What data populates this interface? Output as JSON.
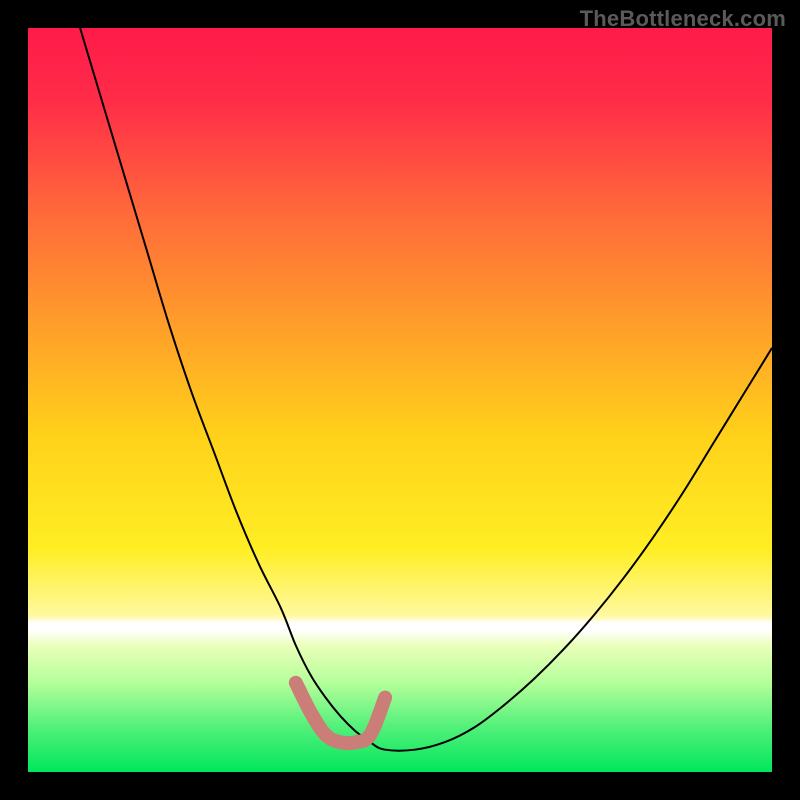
{
  "watermark": "TheBottleneck.com",
  "chart_data": {
    "type": "line",
    "title": "",
    "xlabel": "",
    "ylabel": "",
    "xlim": [
      0,
      100
    ],
    "ylim": [
      0,
      100
    ],
    "grid": false,
    "legend": false,
    "background_gradient": {
      "top_color": "#ff1a4a",
      "mid_color": "#ffe600",
      "bottom_color": "#00e65c",
      "white_band_y_pct": 80
    },
    "series": [
      {
        "name": "bottleneck-curve",
        "color": "#000000",
        "stroke_width": 2,
        "x": [
          7,
          10,
          13,
          16,
          19,
          22,
          25,
          28,
          31,
          34,
          36,
          38,
          40,
          42,
          44,
          46,
          48,
          52,
          56,
          60,
          64,
          68,
          72,
          76,
          80,
          84,
          88,
          92,
          96,
          100
        ],
        "y": [
          100,
          90,
          80,
          70,
          60,
          51,
          43,
          35,
          28,
          22,
          17,
          13,
          10,
          7.5,
          5.5,
          4,
          3,
          3,
          4,
          6,
          9,
          12.5,
          16.5,
          21,
          26,
          31.5,
          37.5,
          44,
          50.5,
          57
        ]
      },
      {
        "name": "highlight-segment",
        "color": "#cb7d78",
        "stroke_width": 14,
        "linecap": "round",
        "x": [
          36,
          38,
          40,
          42,
          44,
          46,
          48
        ],
        "y": [
          12,
          8,
          5,
          4,
          4,
          5,
          10
        ]
      }
    ]
  }
}
